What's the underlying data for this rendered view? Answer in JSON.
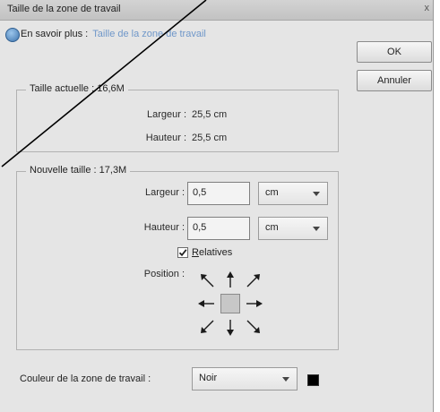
{
  "window": {
    "title": "Taille de la zone de travail",
    "close_symbol": "x"
  },
  "help": {
    "prefix": "En savoir plus :",
    "link_text": "Taille de la zone de travail"
  },
  "buttons": {
    "ok": "OK",
    "cancel": "Annuler"
  },
  "current_size": {
    "legend": "Taille actuelle : 16,6M",
    "width_label": "Largeur :",
    "width_value": "25,5 cm",
    "height_label": "Hauteur :",
    "height_value": "25,5 cm"
  },
  "new_size": {
    "legend": "Nouvelle taille : 17,3M",
    "width_label": "Largeur :",
    "width_value": "0,5",
    "width_unit": "cm",
    "height_label": "Hauteur :",
    "height_value": "0,5",
    "height_unit": "cm",
    "relative_label_accel": "R",
    "relative_label_rest": "elatives",
    "relative_checked": true,
    "position_label": "Position :"
  },
  "canvas_color": {
    "label": "Couleur de la zone de travail :",
    "value": "Noir",
    "swatch_color": "#000000"
  },
  "icons": {
    "help": "help-circle-icon",
    "anchor_arrows": [
      "arrow-up-left-icon",
      "arrow-up-icon",
      "arrow-up-right-icon",
      "arrow-left-icon",
      "arrow-right-icon",
      "arrow-down-left-icon",
      "arrow-down-icon",
      "arrow-down-right-icon"
    ]
  }
}
